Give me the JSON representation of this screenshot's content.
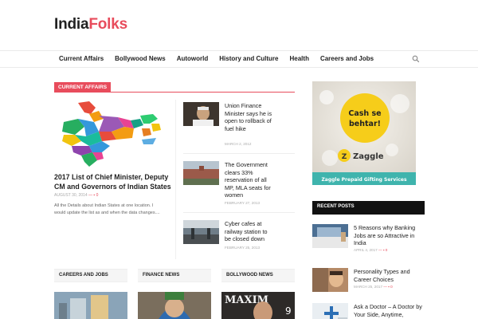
{
  "logo": {
    "part1": "India",
    "part2": "Folks"
  },
  "nav": {
    "items": [
      "Current Affairs",
      "Bollywood News",
      "Autoworld",
      "History and Culture",
      "Health",
      "Careers and Jobs"
    ],
    "search_icon": "search-icon"
  },
  "section": {
    "label": "CURRENT AFFAIRS"
  },
  "feature": {
    "title": "2017 List of Chief Minister, Deputy CM and Governors of Indian States",
    "date": "AUGUST 30, 2014",
    "comments": "0",
    "excerpt": "All the Details about Indian States at one location. I would update the list as and when the data changes...."
  },
  "side_list": [
    {
      "title": "Union Finance Minister says he is open to rollback of fuel hike",
      "date": "MARCH 2, 2012"
    },
    {
      "title": "The Government clears 33% reservation of all MP, MLA seats for women",
      "date": "FEBRUARY 27, 2013"
    },
    {
      "title": "Cyber cafes at railway station to be closed down",
      "date": "FEBRUARY 25, 2013"
    }
  ],
  "categories": [
    "CAREERS AND JOBS",
    "FINANCE NEWS",
    "BOLLYWOOD NEWS"
  ],
  "ad": {
    "headline1": "Cash se",
    "headline2": "behtar!",
    "brand": "Zaggle",
    "footer": "Zaggle Prepaid Gifting Services"
  },
  "recent": {
    "header": "RECENT POSTS",
    "items": [
      {
        "title": "5 Reasons why Banking Jobs are so Attractive in India",
        "date": "APRIL 4, 2017",
        "comments": "0"
      },
      {
        "title": "Personality Types and Career Choices",
        "date": "MARCH 25, 2017",
        "comments": "0"
      },
      {
        "title": "Ask a Doctor – A Doctor by Your Side, Anytime,",
        "date": "",
        "comments": ""
      }
    ]
  },
  "colors": {
    "accent": "#e84c5c",
    "zaggle_yellow": "#f6cd1a",
    "zaggle_teal": "#3fb4ad"
  }
}
